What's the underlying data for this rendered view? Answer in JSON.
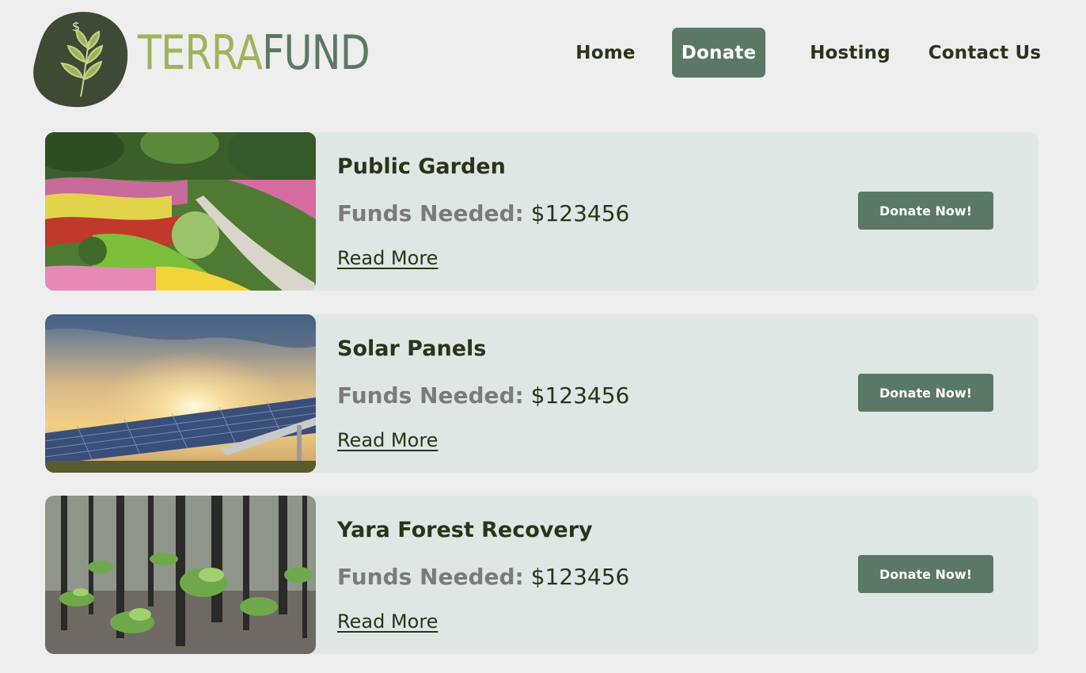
{
  "brand": {
    "name_part1": "TERRA",
    "name_part2": "FUND",
    "logo_symbol": "$",
    "colors": {
      "terra": "#9fb35c",
      "fund": "#5d7865",
      "blob": "#3f4a35"
    }
  },
  "nav": {
    "items": [
      {
        "label": "Home",
        "active": false
      },
      {
        "label": "Donate",
        "active": true
      },
      {
        "label": "Hosting",
        "active": false
      },
      {
        "label": "Contact Us",
        "active": false
      }
    ]
  },
  "theme": {
    "accent": "#5b7866",
    "card_bg": "#dfe7e5",
    "page_bg": "#eeeeee",
    "text_dark": "#2b3319",
    "text_muted": "#7b7b7b"
  },
  "projects": [
    {
      "title": "Public Garden",
      "funds_label": "Funds Needed:",
      "funds_value": "$123456",
      "read_more": "Read More",
      "button": "Donate Now!",
      "image": "garden-photo"
    },
    {
      "title": "Solar Panels",
      "funds_label": "Funds Needed:",
      "funds_value": "$123456",
      "read_more": "Read More",
      "button": "Donate Now!",
      "image": "solar-panel-photo"
    },
    {
      "title": "Yara Forest Recovery",
      "funds_label": "Funds Needed:",
      "funds_value": "$123456",
      "read_more": "Read More",
      "button": "Donate Now!",
      "image": "forest-photo"
    }
  ]
}
